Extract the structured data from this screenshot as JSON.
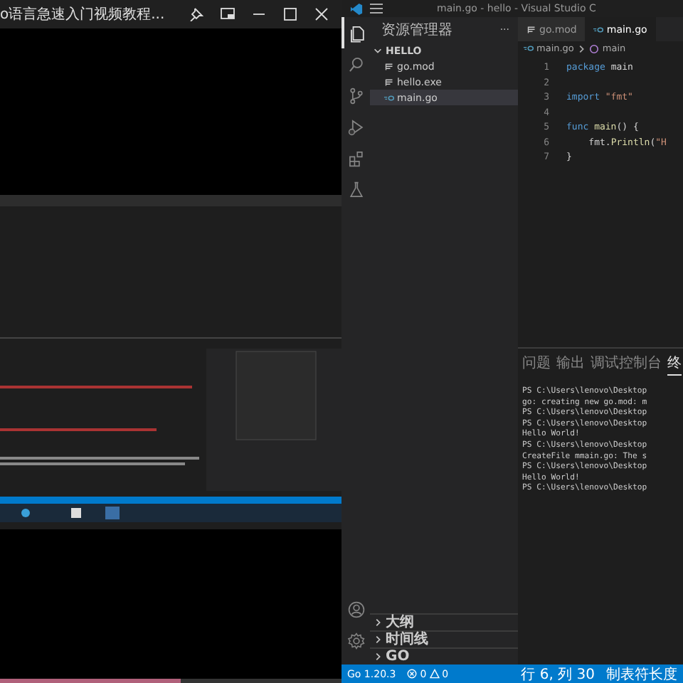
{
  "player": {
    "title": "o语言急速入门视频教程...",
    "progress": {
      "level": 0.53
    }
  },
  "vscode": {
    "title": "main.go - hello - Visual Studio C",
    "activity": [
      {
        "kind": "explorer",
        "selected": true
      },
      {
        "kind": "search",
        "selected": false
      },
      {
        "kind": "scm",
        "selected": false
      },
      {
        "kind": "debug",
        "selected": false
      },
      {
        "kind": "extensions",
        "selected": false
      },
      {
        "kind": "testing",
        "selected": false
      }
    ],
    "activity_bottom": [
      {
        "kind": "account"
      },
      {
        "kind": "settings"
      }
    ],
    "sidebar": {
      "header": "资源管理器",
      "more": "···",
      "folder": {
        "label": "HELLO",
        "expanded": true,
        "children": [
          {
            "label": "go.mod",
            "kind": "mod",
            "selected": false
          },
          {
            "label": "hello.exe",
            "kind": "mod",
            "selected": false
          },
          {
            "label": "main.go",
            "kind": "go",
            "selected": true
          }
        ]
      },
      "sections": [
        {
          "label": "大纲",
          "expanded": false
        },
        {
          "label": "时间线",
          "expanded": false
        },
        {
          "label": "GO",
          "expanded": false
        }
      ]
    },
    "tabs": [
      {
        "label": "go.mod",
        "kind": "mod",
        "selected": false
      },
      {
        "label": "main.go",
        "kind": "go",
        "selected": true
      }
    ],
    "breadcrumb": [
      "main.go",
      "main"
    ],
    "code": [
      {
        "number": "1",
        "tokens": [
          {
            "kind": "keyword",
            "text": "package"
          },
          {
            "kind": "plain",
            "text": " main"
          }
        ]
      },
      {
        "number": "2"
      },
      {
        "number": "3",
        "tokens": [
          {
            "kind": "keyword",
            "text": "import"
          },
          {
            "kind": "string",
            "text": " \"fmt\""
          }
        ]
      },
      {
        "number": "4"
      },
      {
        "number": "5",
        "tokens": [
          {
            "kind": "keyword",
            "text": "func"
          },
          {
            "kind": "function",
            "text": " main"
          },
          {
            "kind": "plain",
            "text": "() {"
          }
        ]
      },
      {
        "number": "6",
        "tokens": [
          {
            "kind": "plain",
            "text": "    fmt."
          },
          {
            "kind": "function",
            "text": "Println"
          },
          {
            "kind": "plain",
            "text": "("
          },
          {
            "kind": "string",
            "text": "\"H"
          }
        ]
      },
      {
        "number": "7",
        "tokens": [
          {
            "kind": "plain",
            "text": "}"
          }
        ]
      }
    ],
    "panel_tabs": [
      {
        "label": "问题",
        "selected": false
      },
      {
        "label": "输出",
        "selected": false
      },
      {
        "label": "调试控制台",
        "selected": false
      },
      {
        "label": "终",
        "selected": true
      }
    ],
    "terminal": [
      "PS C:\\Users\\lenovo\\Desktop",
      "go: creating new go.mod: m",
      "PS C:\\Users\\lenovo\\Desktop",
      "PS C:\\Users\\lenovo\\Desktop",
      "Hello World!",
      "PS C:\\Users\\lenovo\\Desktop",
      "CreateFile mmain.go: The s",
      "PS C:\\Users\\lenovo\\Desktop",
      "Hello World!",
      "PS C:\\Users\\lenovo\\Desktop"
    ],
    "status_bar": {
      "go_version": "Go 1.20.3",
      "errors": "0",
      "warnings": "0",
      "position": "行 6, 列 30",
      "indent": "制表符长度"
    }
  }
}
